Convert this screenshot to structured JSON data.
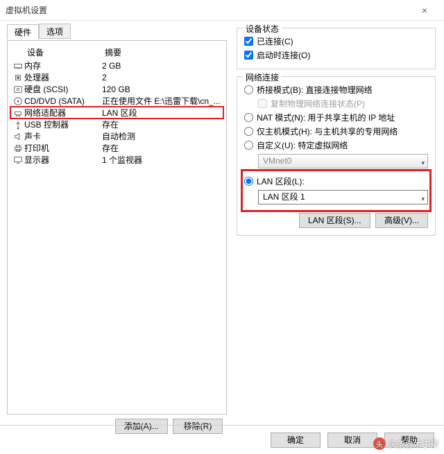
{
  "title": "虚拟机设置",
  "tabs": {
    "hardware": "硬件",
    "options": "选项"
  },
  "columns": {
    "device": "设备",
    "summary": "摘要"
  },
  "devices": [
    {
      "icon": "memory",
      "name": "内存",
      "summary": "2 GB"
    },
    {
      "icon": "cpu",
      "name": "处理器",
      "summary": "2"
    },
    {
      "icon": "disk",
      "name": "硬盘 (SCSI)",
      "summary": "120 GB"
    },
    {
      "icon": "cd",
      "name": "CD/DVD (SATA)",
      "summary": "正在使用文件 E:\\迅雷下载\\cn_..."
    },
    {
      "icon": "net",
      "name": "网络适配器",
      "summary": "LAN 区段",
      "highlight": true
    },
    {
      "icon": "usb",
      "name": "USB 控制器",
      "summary": "存在"
    },
    {
      "icon": "sound",
      "name": "声卡",
      "summary": "自动检测"
    },
    {
      "icon": "printer",
      "name": "打印机",
      "summary": "存在"
    },
    {
      "icon": "display",
      "name": "显示器",
      "summary": "1 个监视器"
    }
  ],
  "left_buttons": {
    "add": "添加(A)...",
    "remove": "移除(R)"
  },
  "status": {
    "title": "设备状态",
    "connected": "已连接(C)",
    "connect_at_power_on": "启动时连接(O)"
  },
  "network": {
    "title": "网络连接",
    "bridged": "桥接模式(B): 直接连接物理网络",
    "replicate": "复制物理网络连接状态(P)",
    "nat": "NAT 模式(N): 用于共享主机的 IP 地址",
    "hostonly": "仅主机模式(H): 与主机共享的专用网络",
    "custom": "自定义(U): 特定虚拟网络",
    "custom_value": "VMnet0",
    "lan": "LAN 区段(L):",
    "lan_value": "LAN 区段 1",
    "lan_segments_btn": "LAN 区段(S)...",
    "advanced_btn": "高级(V)..."
  },
  "footer": {
    "ok": "确定",
    "cancel": "取消",
    "help": "帮助"
  },
  "watermark": "头条@木丁师"
}
